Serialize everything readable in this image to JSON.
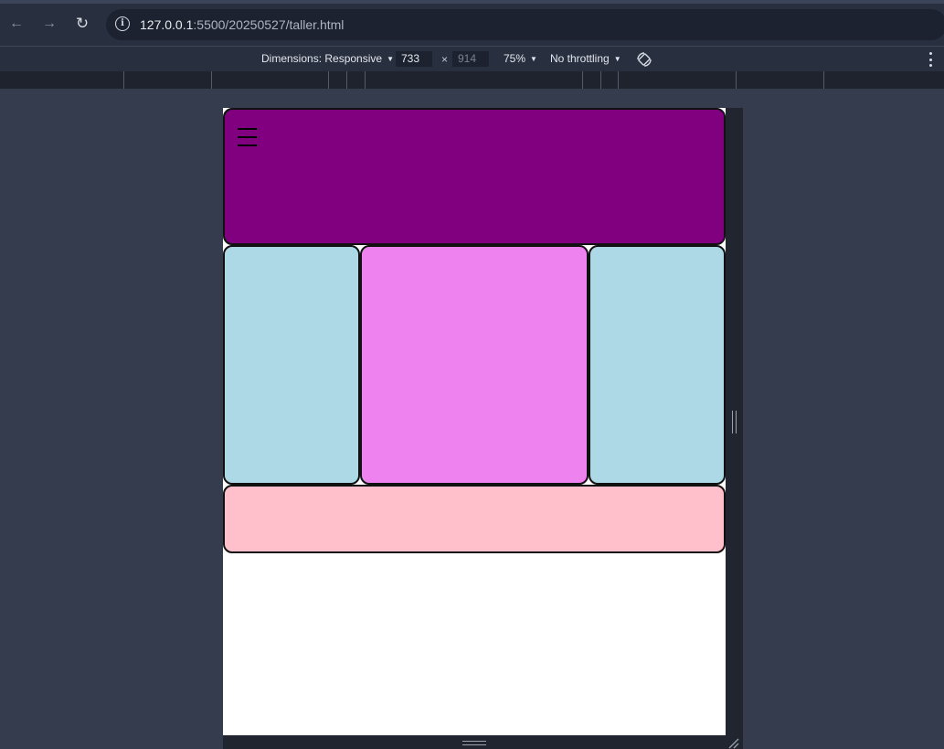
{
  "browser": {
    "url_host": "127.0.0.1",
    "url_rest": ":5500/20250527/taller.html",
    "back_glyph": "←",
    "forward_glyph": "→",
    "reload_glyph": "↻",
    "info_glyph": "i"
  },
  "devtools": {
    "dimensions_label": "Dimensions: Responsive",
    "width": "733",
    "height": "914",
    "times": "×",
    "zoom": "75%",
    "throttling": "No throttling",
    "caret": "▼",
    "rotate_icon": "rotate-icon",
    "more_icon": "more-vertical-icon"
  },
  "page": {
    "menu_icon": "hamburger-icon",
    "colors": {
      "header": "#800080",
      "sidebar_left": "#add8e6",
      "main": "#ee82ee",
      "sidebar_right": "#add8e6",
      "footer": "#ffc0cb",
      "background": "#ffffff"
    }
  }
}
